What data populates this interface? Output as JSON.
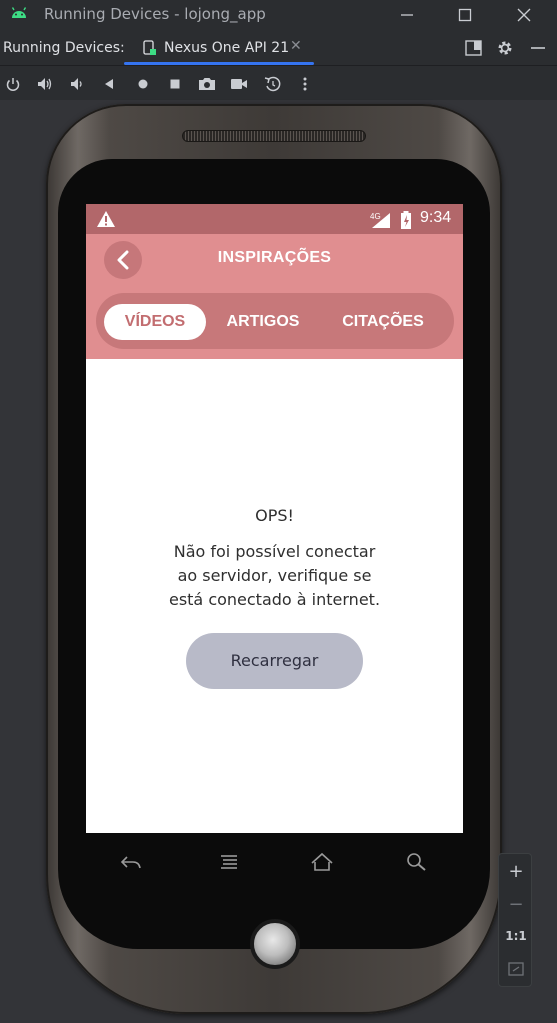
{
  "window": {
    "title": "Running Devices - lojong_app",
    "icon": "android-icon",
    "controls": [
      "minimize-icon",
      "maximize-icon",
      "close-icon"
    ]
  },
  "tool_window": {
    "label": "Running Devices:",
    "active_tab": "Nexus One API 21",
    "tab_close": "✕"
  },
  "toolbar": {
    "icons": [
      "power-icon",
      "volume-up-icon",
      "volume-down-icon",
      "back-triangle-icon",
      "home-circle-icon",
      "overview-square-icon",
      "camera-icon",
      "record-icon",
      "rotate-icon",
      "more-icon"
    ]
  },
  "status_bar": {
    "network": "4G",
    "time": "9:34"
  },
  "app": {
    "title": "INSPIRAÇÕES",
    "tabs": [
      {
        "label": "VÍDEOS",
        "active": true
      },
      {
        "label": "ARTIGOS",
        "active": false
      },
      {
        "label": "CITAÇÕES",
        "active": false
      }
    ],
    "error_title": "OPS!",
    "error_lines": [
      "Não foi possível conectar",
      "ao servidor, verifique se",
      "está conectado à internet."
    ],
    "reload_label": "Recarregar"
  },
  "zoom": {
    "plus": "+",
    "minus": "−",
    "actual_size": "1:1"
  },
  "colors": {
    "status_bar": "#b2676a",
    "app_bar": "#e08e90",
    "tab_track": "#c7787a",
    "active_tab_text": "#c26d70",
    "reload_button": "#b8bac8",
    "ide_accent": "#3574f0"
  }
}
